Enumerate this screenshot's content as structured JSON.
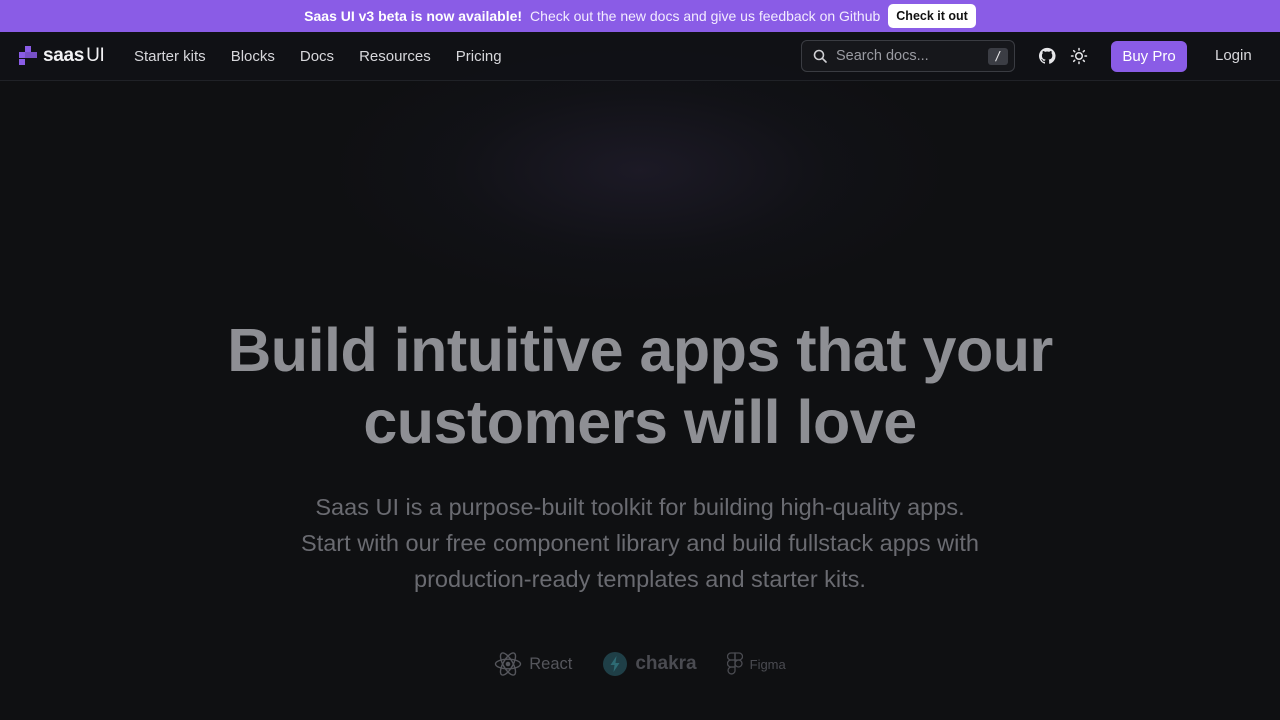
{
  "banner": {
    "headline": "Saas UI v3 beta is now available!",
    "message": "Check out the new docs and give us feedback on Github",
    "cta": "Check it out"
  },
  "logo": {
    "name_main": "saas",
    "name_suffix": "UI"
  },
  "nav": {
    "links": [
      "Starter kits",
      "Blocks",
      "Docs",
      "Resources",
      "Pricing"
    ],
    "search_placeholder": "Search docs...",
    "search_shortcut": "/",
    "buy_label": "Buy Pro",
    "login_label": "Login"
  },
  "hero": {
    "title_line1": "Build intuitive apps that your",
    "title_line2": "customers will love",
    "sub_line1": "Saas UI is a purpose-built toolkit for building high-quality apps.",
    "sub_line2": "Start with our free component library and build fullstack apps with",
    "sub_line3": "production-ready templates and starter kits."
  },
  "tech": [
    "React",
    "chakra",
    "Figma"
  ],
  "colors": {
    "accent": "#8a5ce6",
    "background": "#0f1012"
  },
  "icons": [
    "search-icon",
    "github-icon",
    "sun-icon",
    "react-icon",
    "chakra-icon",
    "figma-icon"
  ]
}
